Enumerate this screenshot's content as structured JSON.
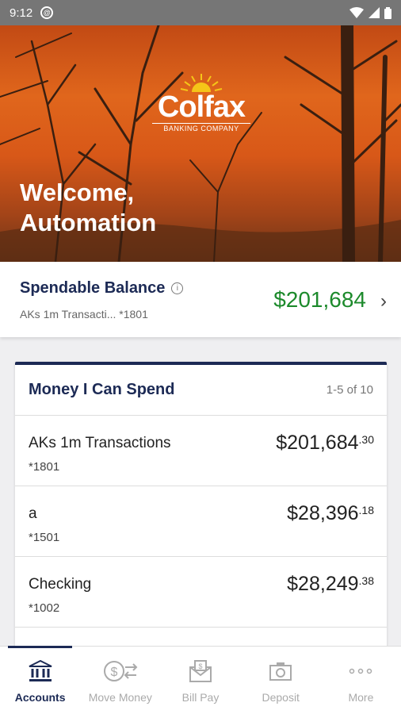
{
  "status_bar": {
    "time": "9:12"
  },
  "hero": {
    "brand": "Colfax",
    "brand_sub": "BANKING COMPANY",
    "welcome_line1": "Welcome,",
    "welcome_line2": "Automation"
  },
  "spendable": {
    "title": "Spendable Balance",
    "account": "AKs 1m Transacti... *1801",
    "amount": "$201,684"
  },
  "card": {
    "title": "Money I Can Spend",
    "count": "1-5 of 10",
    "accounts": [
      {
        "name": "AKs 1m Transactions",
        "number": "*1801",
        "whole": "$201,684",
        "cents": ".30"
      },
      {
        "name": "a",
        "number": "*1501",
        "whole": "$28,396",
        "cents": ".18"
      },
      {
        "name": "Checking",
        "number": "*1002",
        "whole": "$28,249",
        "cents": ".38"
      }
    ]
  },
  "nav": [
    {
      "label": "Accounts",
      "icon": "bank-icon",
      "active": true
    },
    {
      "label": "Move Money",
      "icon": "transfer-icon",
      "active": false
    },
    {
      "label": "Bill Pay",
      "icon": "bill-envelope-icon",
      "active": false
    },
    {
      "label": "Deposit",
      "icon": "camera-icon",
      "active": false
    },
    {
      "label": "More",
      "icon": "more-dots-icon",
      "active": false
    }
  ],
  "colors": {
    "navy": "#1c2a55",
    "positive": "#1d8a2c",
    "hero": "#e0661c"
  }
}
